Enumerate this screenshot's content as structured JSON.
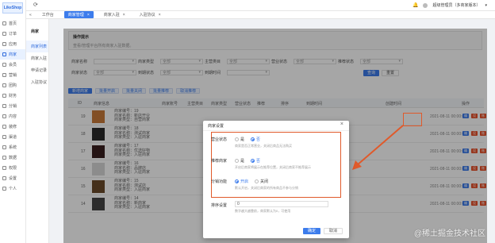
{
  "app": {
    "logo": "LikeShop"
  },
  "rail": {
    "items": [
      {
        "label": "首页",
        "icon": "home-icon"
      },
      {
        "label": "订单",
        "icon": "order-icon"
      },
      {
        "label": "应用",
        "icon": "apps-icon"
      },
      {
        "label": "商家",
        "icon": "shop-icon"
      },
      {
        "label": "会员",
        "icon": "user-icon"
      },
      {
        "label": "营销",
        "icon": "megaphone-icon"
      },
      {
        "label": "团购",
        "icon": "group-icon"
      },
      {
        "label": "财务",
        "icon": "wallet-icon"
      },
      {
        "label": "分销",
        "icon": "share-icon"
      },
      {
        "label": "内容",
        "icon": "document-icon"
      },
      {
        "label": "装修",
        "icon": "brush-icon"
      },
      {
        "label": "渠道",
        "icon": "channel-icon"
      },
      {
        "label": "系统",
        "icon": "gear-icon"
      },
      {
        "label": "数据",
        "icon": "chart-icon"
      },
      {
        "label": "权限",
        "icon": "lock-icon"
      },
      {
        "label": "设置",
        "icon": "settings-icon"
      },
      {
        "label": "个人",
        "icon": "person-icon"
      }
    ],
    "active_index": 3
  },
  "subnav": {
    "title": "商家",
    "items": [
      "商家列表",
      "商家入驻",
      "申请记录",
      "入驻协议"
    ],
    "active_index": 0
  },
  "topbar": {
    "user": "超级管理员（多商家版本）",
    "caret": "▾"
  },
  "tabs": [
    {
      "label": "工作台",
      "active": false
    },
    {
      "label": "商家管理",
      "active": true
    },
    {
      "label": "商家入驻",
      "active": false
    },
    {
      "label": "入驻协议",
      "active": false
    }
  ],
  "tips": {
    "title": "操作提示",
    "text": "查看/管理平台所有商家入驻数据。"
  },
  "filters": {
    "row1": [
      {
        "label": "商家名称",
        "value": ""
      },
      {
        "label": "商家类型",
        "value": "全部"
      },
      {
        "label": "主营类目",
        "value": "全部"
      },
      {
        "label": "营业状态",
        "value": "全部"
      },
      {
        "label": "推荐状态",
        "value": "全部"
      }
    ],
    "row2": [
      {
        "label": "商家状态",
        "value": "全部"
      },
      {
        "label": "到期状态",
        "value": "全部"
      },
      {
        "label": "到期时间",
        "value": ""
      }
    ],
    "search_label": "查询",
    "reset_label": "重置"
  },
  "toolbar": [
    "新增商家",
    "批量开启",
    "批量关闭",
    "批量推荐",
    "取消推荐"
  ],
  "table": {
    "headers": [
      "ID",
      "商家信息",
      "商家账号",
      "主营类目",
      "商家类型",
      "营业状态",
      "推荐",
      "排序",
      "到期时间",
      "创建时间",
      "操作"
    ],
    "rows": [
      {
        "id": "19",
        "line1": "商家编号：19",
        "line2": "商家名称：新店开业",
        "line3": "商家类型：自营商家",
        "time": "2021-08-11 00:00:00",
        "thumb": "#c87a3a"
      },
      {
        "id": "18",
        "line1": "商家编号：18",
        "line2": "商家名称：测试商家",
        "line3": "商家类型：入驻商家",
        "time": "2021-08-11 00:00:00",
        "thumb": "#2a2a2a"
      },
      {
        "id": "17",
        "line1": "商家编号：17",
        "line2": "商家名称：优选好物",
        "line3": "商家类型：入驻商家",
        "time": "2021-08-11 00:00:00",
        "thumb": "#3a2020"
      },
      {
        "id": "16",
        "line1": "商家编号：16",
        "line2": "商家名称：品牌店",
        "line3": "商家类型：入驻商家",
        "time": "2021-08-11 00:00:00",
        "thumb": "#d8d8d8"
      },
      {
        "id": "15",
        "line1": "商家编号：15",
        "line2": "商家名称：测试店",
        "line3": "商家类型：入驻商家",
        "time": "2021-08-11 00:00:00",
        "thumb": "#6b4a2a"
      },
      {
        "id": "14",
        "line1": "商家编号：14",
        "line2": "商家名称：新商家",
        "line3": "商家类型：入驻商家",
        "time": "2021-08-11 00:00:00",
        "thumb": "#444444"
      }
    ],
    "op_labels": {
      "edit": "编辑",
      "delete": "设置",
      "distribute": "账号管理"
    }
  },
  "modal": {
    "title": "商家设置",
    "close": "×",
    "fields": [
      {
        "label": "营业状态",
        "options": [
          "是",
          "否"
        ],
        "selected": 1,
        "hint": "商家是否正常营业，关闭后商品无法购买"
      },
      {
        "label": "推荐商家",
        "options": [
          "是",
          "否"
        ],
        "selected": 1,
        "hint": "开启后商家将展示在推荐位置，关闭后商家不推荐展示"
      },
      {
        "label": "分销功能",
        "options": [
          "开启",
          "关闭"
        ],
        "selected": 0,
        "hint": "默认开启，关闭后商家的所有商品不参与分销"
      }
    ],
    "sort": {
      "label": "排序设置",
      "value": "0",
      "hint": "数字越大越靠前，商家默认为0，可使用"
    },
    "ok_label": "确定",
    "cancel_label": "取消"
  },
  "watermark": "@稀土掘金技术社区",
  "colors": {
    "accent": "#3c7cec",
    "highlight": "#e05a2b",
    "danger": "#e8512a"
  }
}
